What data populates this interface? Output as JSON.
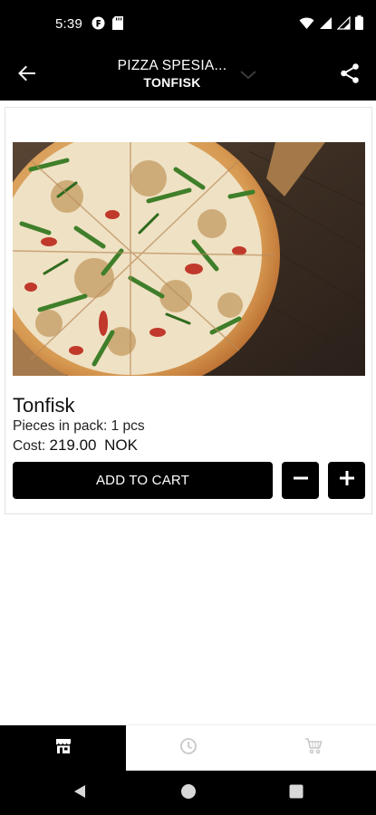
{
  "status_bar": {
    "time": "5:39"
  },
  "app_bar": {
    "title": "PIZZA SPESIA...",
    "subtitle": "TONFISK"
  },
  "product": {
    "name": "Tonfisk",
    "pieces_label": "Pieces in pack:",
    "pieces_value": "1 pcs",
    "cost_label": "Cost:",
    "cost_amount": "219.00",
    "cost_currency": "NOK",
    "add_to_cart_label": "ADD TO CART"
  },
  "icons": {
    "back": "arrow-left-icon",
    "share": "share-icon",
    "dropdown": "chevron-down-icon",
    "minus": "minus-icon",
    "plus": "plus-icon",
    "nav_menu": "storefront-icon",
    "nav_history": "clock-icon",
    "nav_cart": "cart-icon"
  },
  "colors": {
    "bars": "#000000",
    "background": "#ffffff",
    "button": "#000000",
    "inactive_icon": "#c8c8c8"
  },
  "bottom_nav": {
    "active_index": 0
  }
}
